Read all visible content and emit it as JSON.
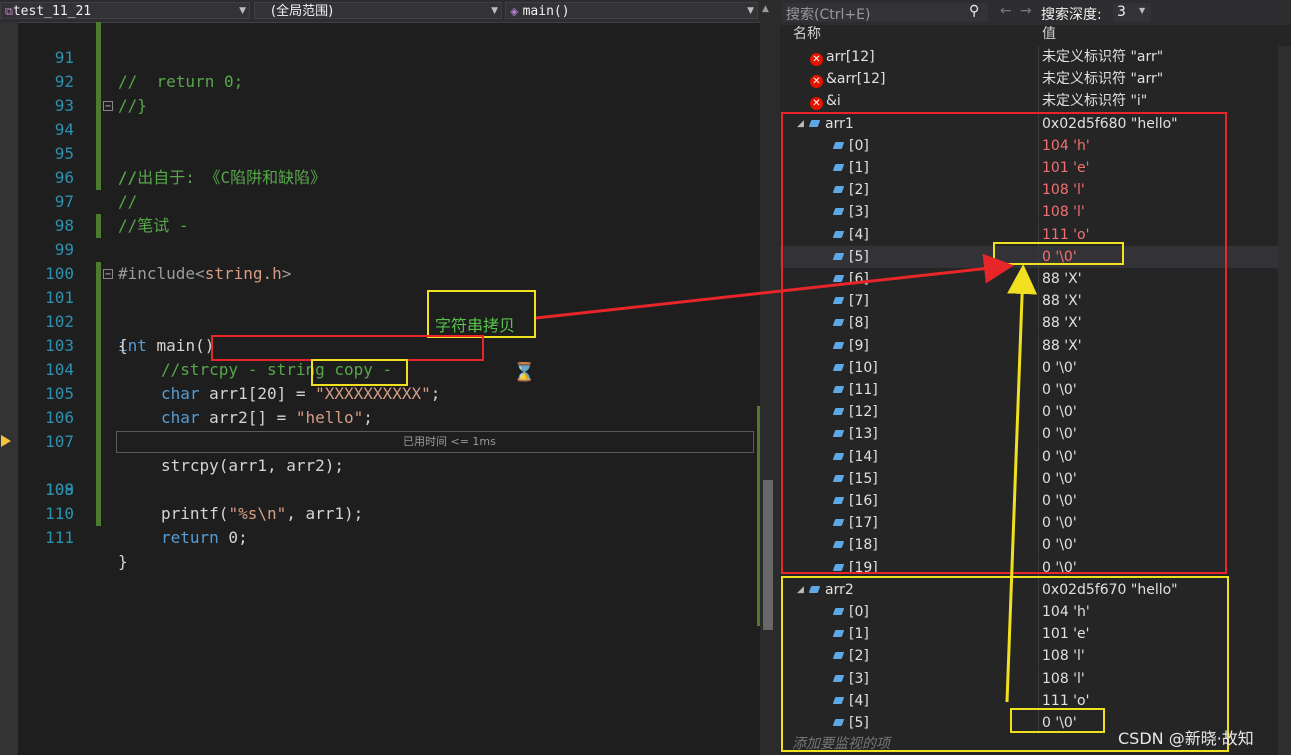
{
  "nav": {
    "project": "test_11_21",
    "scope": "(全局范围)",
    "member": "main()"
  },
  "colors": {
    "red_box": "#e8262a",
    "yellow_box": "#f0e020",
    "changed_value": "#f47070"
  },
  "code": [
    {
      "ln": "91",
      "text": "//  return 0;"
    },
    {
      "ln": "92",
      "text": "//}"
    },
    {
      "ln": "93",
      "text": ""
    },
    {
      "ln": "94",
      "text": "//"
    },
    {
      "ln": "95",
      "text": "//出自于: 《C陷阱和缺陷》"
    },
    {
      "ln": "96",
      "text": "//"
    },
    {
      "ln": "97",
      "text": "//笔试 -"
    },
    {
      "ln": "98",
      "text": ""
    },
    {
      "ln": "99",
      "pp": "#include<",
      "inc": "string.h",
      "ppe": ">"
    },
    {
      "ln": "100",
      "text": ""
    },
    {
      "ln": "101",
      "kw": "int",
      "rest": " main()"
    },
    {
      "ln": "102",
      "text": "{"
    },
    {
      "ln": "103",
      "comment": "//strcpy - string copy - ",
      "annot": "字符串拷贝"
    },
    {
      "ln": "104",
      "kw": "char",
      "rest": " arr1[20] = ",
      "str": "\"XXXXXXXXXX\"",
      "end": ";"
    },
    {
      "ln": "105",
      "kw": "char",
      "rest": " arr2[] = ",
      "str": "\"hello\"",
      "end": ";"
    },
    {
      "ln": "106",
      "text": ""
    },
    {
      "ln": "107",
      "text": "strcpy(arr1, arr2);"
    },
    {
      "ln": "108",
      "pre": "printf(",
      "str": "\"%s\\n\"",
      "post": ", arr1);",
      "perf": "已用时间 <= 1ms"
    },
    {
      "ln": "109",
      "text": ""
    },
    {
      "ln": "110",
      "kw": "return",
      "rest": " 0;"
    },
    {
      "ln": "111",
      "text": "}"
    }
  ],
  "watch": {
    "search_placeholder": "搜索(Ctrl+E)",
    "search_depth_label": "搜索深度:",
    "search_depth_value": "3",
    "col_name": "名称",
    "col_value": "值",
    "errors": [
      {
        "name": "arr[12]",
        "value": "未定义标识符 \"arr\""
      },
      {
        "name": "&arr[12]",
        "value": "未定义标识符 \"arr\""
      },
      {
        "name": "&i",
        "value": "未定义标识符 \"i\""
      }
    ],
    "arr1": {
      "name": "arr1",
      "value": "0x02d5f680 \"hello\"",
      "items": [
        {
          "i": "[0]",
          "v": "104 'h'"
        },
        {
          "i": "[1]",
          "v": "101 'e'"
        },
        {
          "i": "[2]",
          "v": "108 'l'"
        },
        {
          "i": "[3]",
          "v": "108 'l'"
        },
        {
          "i": "[4]",
          "v": "111 'o'"
        },
        {
          "i": "[5]",
          "v": "0 '\\0'"
        },
        {
          "i": "[6]",
          "v": "88 'X'"
        },
        {
          "i": "[7]",
          "v": "88 'X'"
        },
        {
          "i": "[8]",
          "v": "88 'X'"
        },
        {
          "i": "[9]",
          "v": "88 'X'"
        },
        {
          "i": "[10]",
          "v": "0 '\\0'"
        },
        {
          "i": "[11]",
          "v": "0 '\\0'"
        },
        {
          "i": "[12]",
          "v": "0 '\\0'"
        },
        {
          "i": "[13]",
          "v": "0 '\\0'"
        },
        {
          "i": "[14]",
          "v": "0 '\\0'"
        },
        {
          "i": "[15]",
          "v": "0 '\\0'"
        },
        {
          "i": "[16]",
          "v": "0 '\\0'"
        },
        {
          "i": "[17]",
          "v": "0 '\\0'"
        },
        {
          "i": "[18]",
          "v": "0 '\\0'"
        },
        {
          "i": "[19]",
          "v": "0 '\\0'"
        }
      ]
    },
    "arr2": {
      "name": "arr2",
      "value": "0x02d5f670 \"hello\"",
      "items": [
        {
          "i": "[0]",
          "v": "104 'h'"
        },
        {
          "i": "[1]",
          "v": "101 'e'"
        },
        {
          "i": "[2]",
          "v": "108 'l'"
        },
        {
          "i": "[3]",
          "v": "108 'l'"
        },
        {
          "i": "[4]",
          "v": "111 'o'"
        },
        {
          "i": "[5]",
          "v": "0 '\\0'"
        }
      ]
    },
    "add_item": "添加要监视的项"
  },
  "watermark": "CSDN @新晓·故知"
}
